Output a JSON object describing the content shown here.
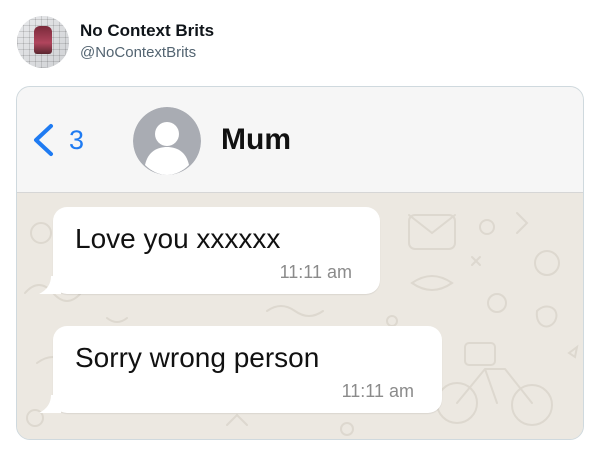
{
  "tweet": {
    "display_name": "No Context Brits",
    "handle": "@NoContextBrits",
    "avatar_icon": "profile-picture"
  },
  "chat": {
    "back_icon": "chevron-left-icon",
    "back_count": "3",
    "contact_avatar_icon": "default-person-icon",
    "contact_name": "Mum",
    "accent_color": "#1f7bf2",
    "wallpaper_color": "#ece8e1",
    "messages": [
      {
        "text": "Love you xxxxxx",
        "time": "11:11 am"
      },
      {
        "text": "Sorry wrong person",
        "time": "11:11 am"
      }
    ]
  }
}
